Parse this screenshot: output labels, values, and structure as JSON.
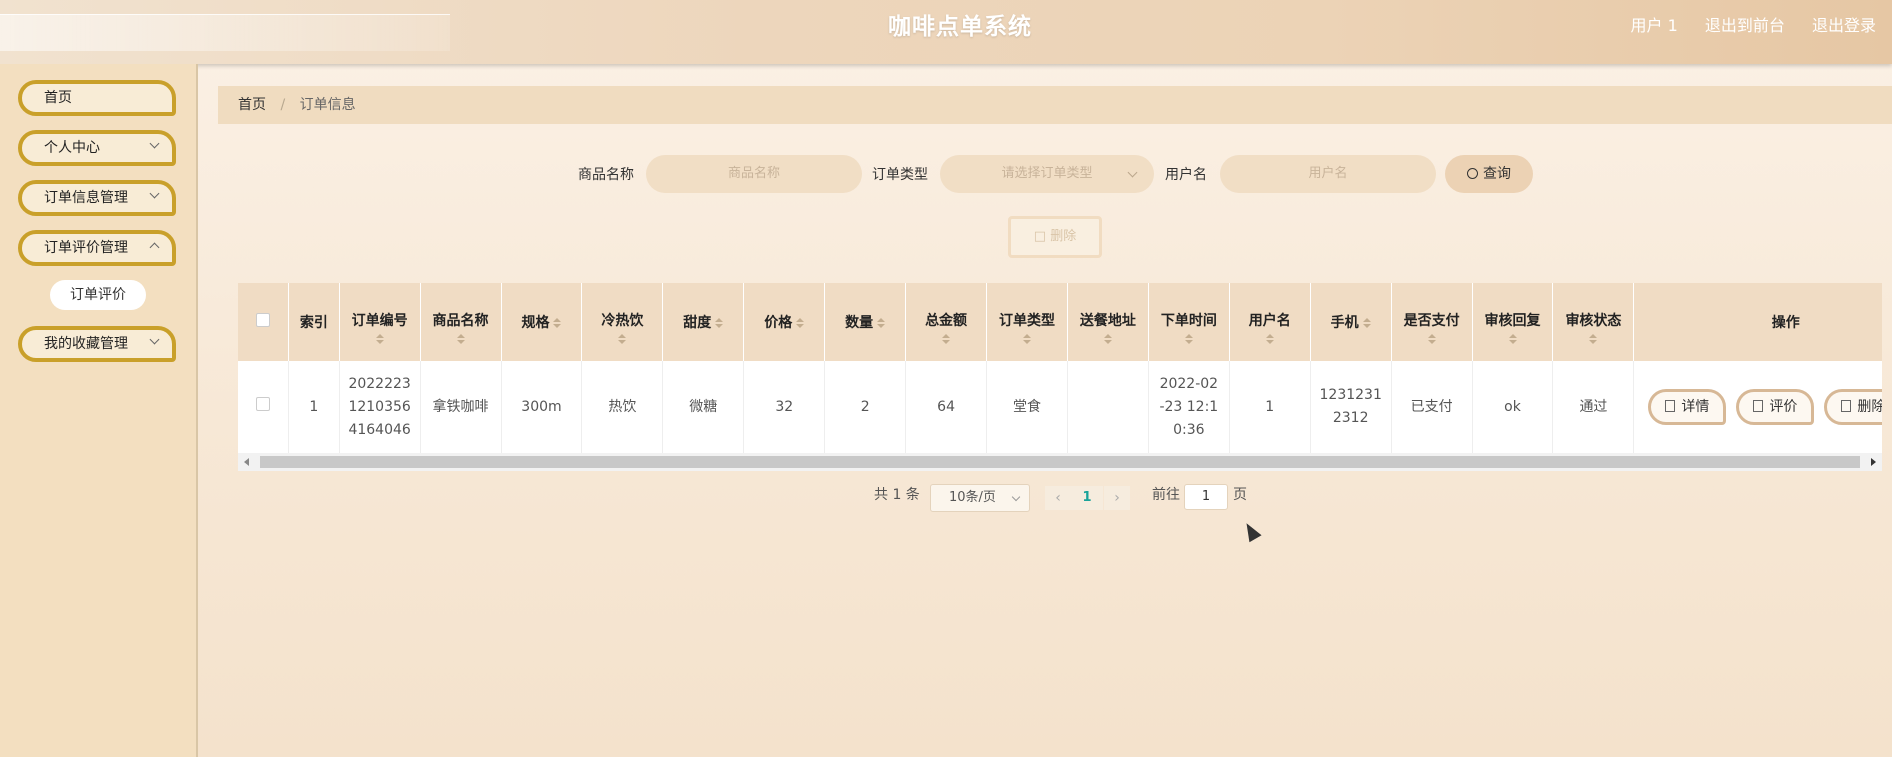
{
  "header": {
    "title": "咖啡点单系统",
    "user": "用户 1",
    "exit_front": "退出到前台",
    "logout": "退出登录"
  },
  "sidebar": {
    "items": [
      {
        "label": "首页"
      },
      {
        "label": "个人中心"
      },
      {
        "label": "订单信息管理"
      },
      {
        "label": "订单评价管理"
      },
      {
        "label": "我的收藏管理"
      }
    ],
    "sub_item": "订单评价"
  },
  "breadcrumb": {
    "home": "首页",
    "separator": "/",
    "current": "订单信息"
  },
  "search": {
    "product_label": "商品名称",
    "product_placeholder": "商品名称",
    "order_type_label": "订单类型",
    "order_type_placeholder": "请选择订单类型",
    "username_label": "用户名",
    "username_placeholder": "用户名",
    "query_button": "查询"
  },
  "toolbar": {
    "delete_button": "删除"
  },
  "table": {
    "headers": [
      "索引",
      "订单编号",
      "商品名称",
      "规格",
      "冷热饮",
      "甜度",
      "价格",
      "数量",
      "总金额",
      "订单类型",
      "送餐地址",
      "下单时间",
      "用户名",
      "手机",
      "是否支付",
      "审核回复",
      "审核状态",
      "操作"
    ],
    "rows": [
      {
        "index": "1",
        "order_no_lines": [
          "2022223",
          "1210356",
          "4164046"
        ],
        "product": "拿铁咖啡",
        "spec": "300m",
        "temperature": "热饮",
        "sweetness": "微糖",
        "price": "32",
        "quantity": "2",
        "total": "64",
        "order_type": "堂食",
        "address": "",
        "time_lines": [
          "2022-02",
          "-23 12:1",
          "0:36"
        ],
        "username": "1",
        "phone_lines": [
          "1231231",
          "2312"
        ],
        "paid": "已支付",
        "review_reply": "ok",
        "review_status": "通过"
      }
    ],
    "actions": [
      "详情",
      "评价",
      "删除"
    ]
  },
  "pagination": {
    "total_text": "共 1 条",
    "page_size": "10条/页",
    "current_page": "1",
    "goto_label": "前往",
    "goto_value": "1",
    "page_suffix": "页"
  }
}
